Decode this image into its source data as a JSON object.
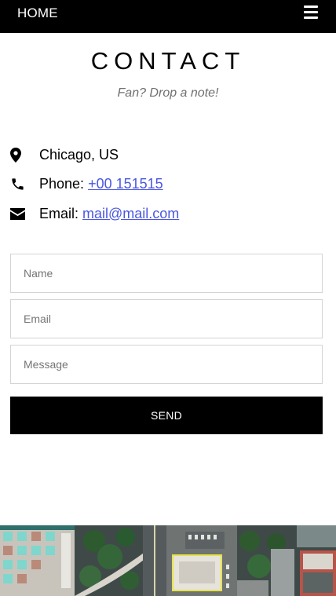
{
  "nav": {
    "home_label": "HOME",
    "menu_icon": "hamburger-menu-icon"
  },
  "header": {
    "title": "CONTACT",
    "subtitle": "Fan? Drop a note!"
  },
  "contact": {
    "location": {
      "icon": "map-marker-icon",
      "text": "Chicago, US"
    },
    "phone": {
      "icon": "phone-icon",
      "label": "Phone:",
      "value": "+00 151515"
    },
    "email": {
      "icon": "envelope-icon",
      "label": "Email:",
      "value": "mail@mail.com"
    }
  },
  "form": {
    "name_placeholder": "Name",
    "email_placeholder": "Email",
    "message_placeholder": "Message",
    "send_label": "SEND"
  },
  "colors": {
    "navbar_bg": "#000000",
    "link": "#4a57e0",
    "button_bg": "#000000",
    "subtitle": "#6f6f6f"
  },
  "footer_image": "aerial-city-photo"
}
